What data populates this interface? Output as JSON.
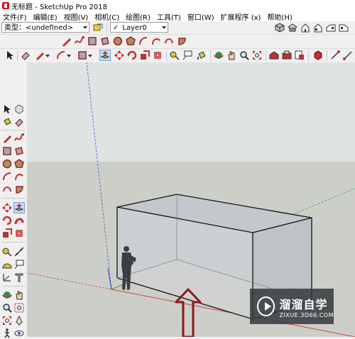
{
  "window": {
    "title": "无标题 - SketchUp Pro 2018"
  },
  "menu": [
    "文件(F)",
    "编辑(E)",
    "视图(V)",
    "相机(C)",
    "绘图(R)",
    "工具(T)",
    "窗口(W)",
    "扩展程序 (x)",
    "帮助(H)"
  ],
  "tag_combo": {
    "label": "类型：",
    "value": "<undefined>"
  },
  "layer_combo": {
    "check": "✓",
    "value": "Layer0"
  },
  "watermark": {
    "brand": "溜溜自学",
    "url": "ZIXUE.3D66.COM"
  },
  "colors": {
    "red_axis": "#d04040",
    "green_axis": "#40a040",
    "blue_axis": "#4040c0",
    "arrow": "#8b1a1a"
  },
  "icons": {
    "top_row": [
      "pencil-icon",
      "freehand-icon",
      "rectangle-icon",
      "rotated-rectangle-icon",
      "circle-icon",
      "polygon-icon",
      "arc-icon",
      "2point-arc-icon",
      "3point-arc-icon",
      "pie-icon"
    ],
    "main_row": [
      "select-icon",
      "eraser-icon",
      "pencil-icon",
      "arc-icon",
      "rectangle-icon",
      "push-pull-icon",
      "move-icon",
      "rotate-icon",
      "scale-icon",
      "offset-icon",
      "tape-icon",
      "text-icon",
      "paint-icon",
      "orbit-icon",
      "pan-icon",
      "zoom-icon",
      "zoom-extents-icon",
      "warehouse-icon",
      "extension-warehouse-icon",
      "send-to-layout-icon",
      "ruby-icon",
      "sandbox-icon",
      "sandbox2-icon"
    ],
    "view_row": [
      "iso-view-icon",
      "top-view-icon",
      "front-view-icon",
      "right-view-icon",
      "back-view-icon",
      "left-view-icon"
    ]
  }
}
